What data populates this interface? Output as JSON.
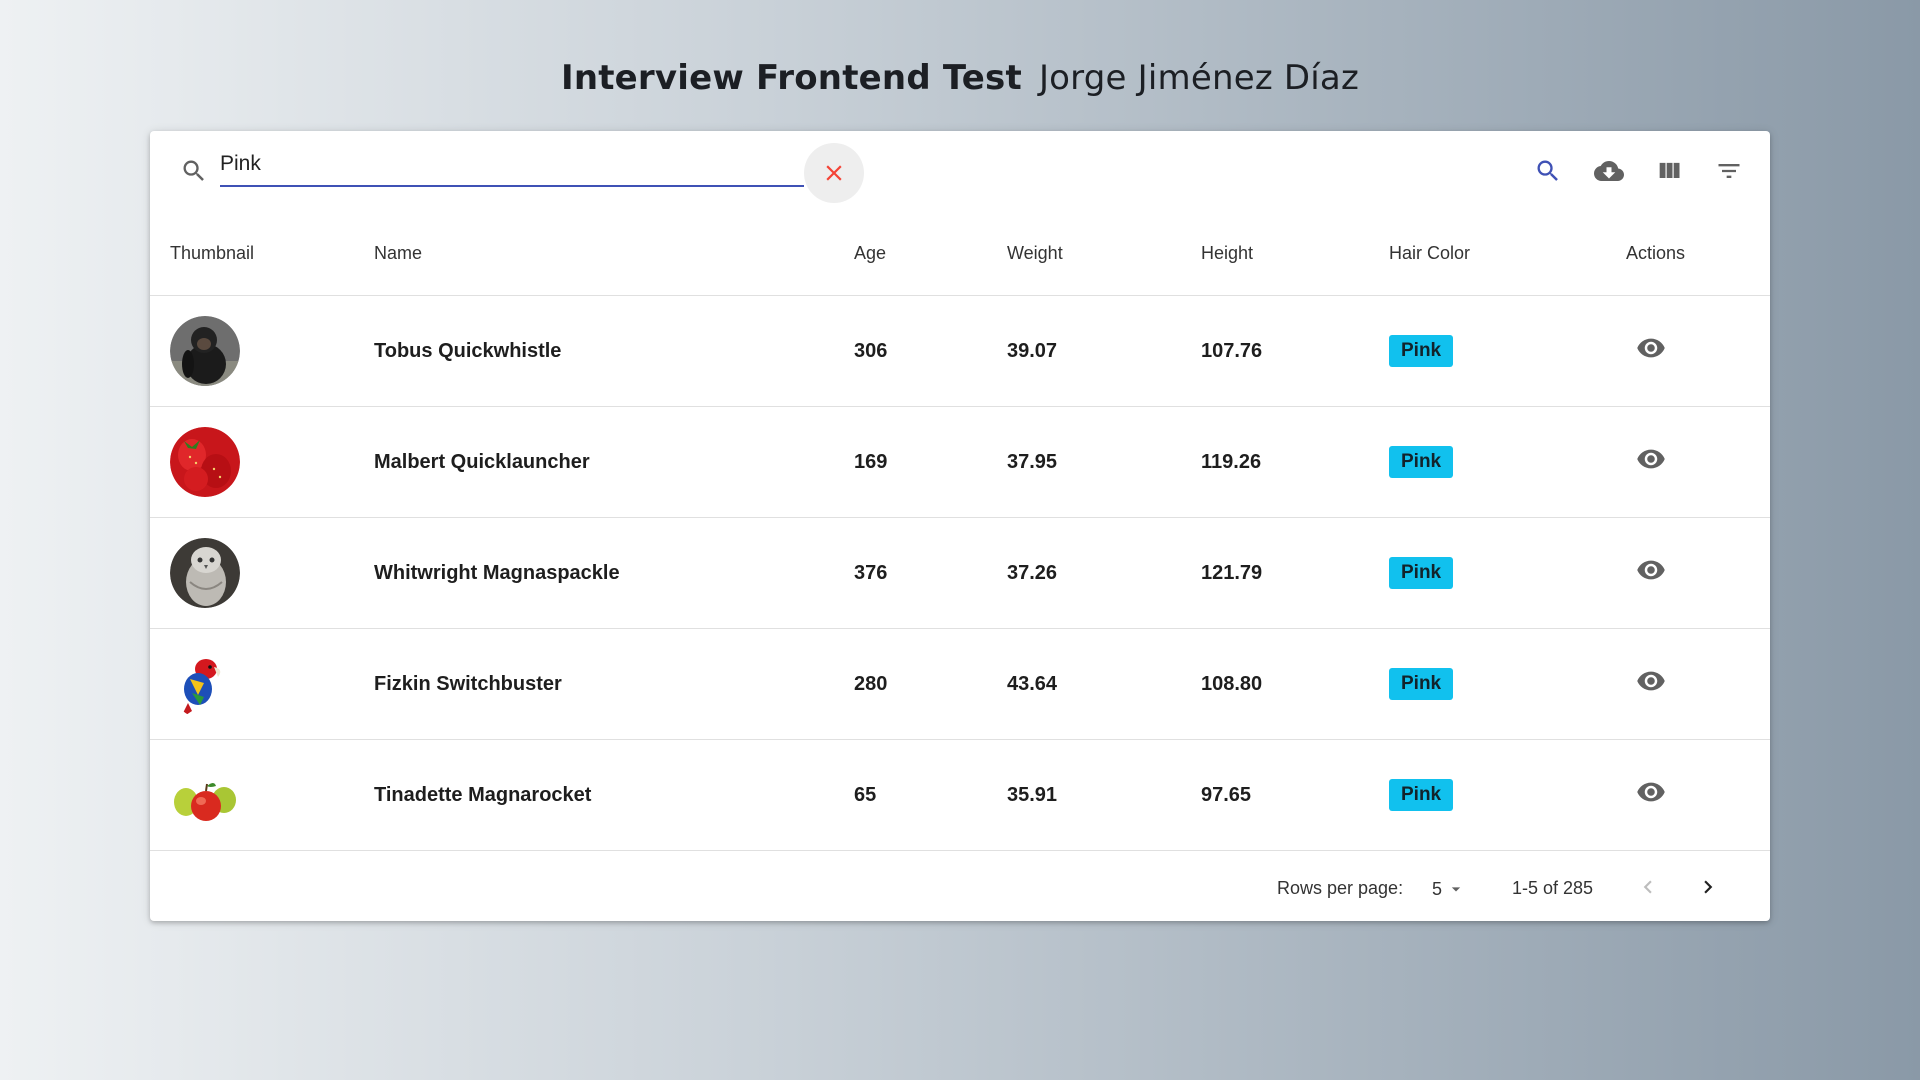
{
  "header": {
    "title": "Interview Frontend Test",
    "author": "Jorge Jiménez Díaz"
  },
  "toolbar": {
    "search_value": "Pink",
    "icons": [
      "search-icon",
      "clear-icon",
      "cloud-download-icon",
      "view-column-icon",
      "filter-list-icon"
    ]
  },
  "table": {
    "columns": [
      "Thumbnail",
      "Name",
      "Age",
      "Weight",
      "Height",
      "Hair Color",
      "Actions"
    ],
    "rows": [
      {
        "thumbnail": "chimpanzee",
        "name": "Tobus Quickwhistle",
        "age": "306",
        "weight": "39.07",
        "height": "107.76",
        "hair_color": "Pink"
      },
      {
        "thumbnail": "strawberries",
        "name": "Malbert Quicklauncher",
        "age": "169",
        "weight": "37.95",
        "height": "119.26",
        "hair_color": "Pink"
      },
      {
        "thumbnail": "owl",
        "name": "Whitwright Magnaspackle",
        "age": "376",
        "weight": "37.26",
        "height": "121.79",
        "hair_color": "Pink"
      },
      {
        "thumbnail": "parrot",
        "name": "Fizkin Switchbuster",
        "age": "280",
        "weight": "43.64",
        "height": "108.80",
        "hair_color": "Pink"
      },
      {
        "thumbnail": "apples",
        "name": "Tinadette Magnarocket",
        "age": "65",
        "weight": "35.91",
        "height": "97.65",
        "hair_color": "Pink"
      }
    ]
  },
  "pagination": {
    "rows_per_page_label": "Rows per page:",
    "rows_per_page": "5",
    "range": "1-5 of 285"
  },
  "colors": {
    "chip": "#11c1ee",
    "accent": "#3f51b5",
    "clear": "#f44336"
  }
}
